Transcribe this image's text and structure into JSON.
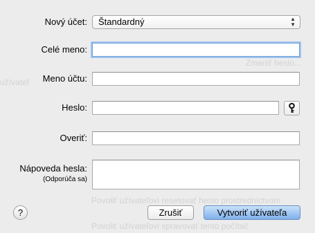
{
  "form": {
    "account_type_label": "Nový účet:",
    "account_type_value": "Štandardný",
    "full_name_label": "Celé meno:",
    "full_name_value": "",
    "account_name_label": "Meno účtu:",
    "account_name_value": "",
    "password_label": "Heslo:",
    "password_value": "",
    "verify_label": "Overiť:",
    "verify_value": "",
    "hint_label": "Nápoveda hesla:",
    "hint_sublabel": "(Odporúča sa)",
    "hint_value": ""
  },
  "buttons": {
    "help": "?",
    "cancel": "Zrušiť",
    "create": "Vytvoriť užívateľa"
  },
  "background": {
    "ghost_users": "užívateľ",
    "ghost_change_password": "Zmeniť heslo...",
    "ghost_allow_admin": "Povoliť užívateľovi resetovať heslo prostredníctvom",
    "ghost_allow_manage": "Povoliť užívateľovi spravovať tento počítač"
  },
  "colors": {
    "sheet_bg": "#ececec",
    "focus_ring": "#9fc3ef",
    "primary_button": "#7fb0ea"
  }
}
